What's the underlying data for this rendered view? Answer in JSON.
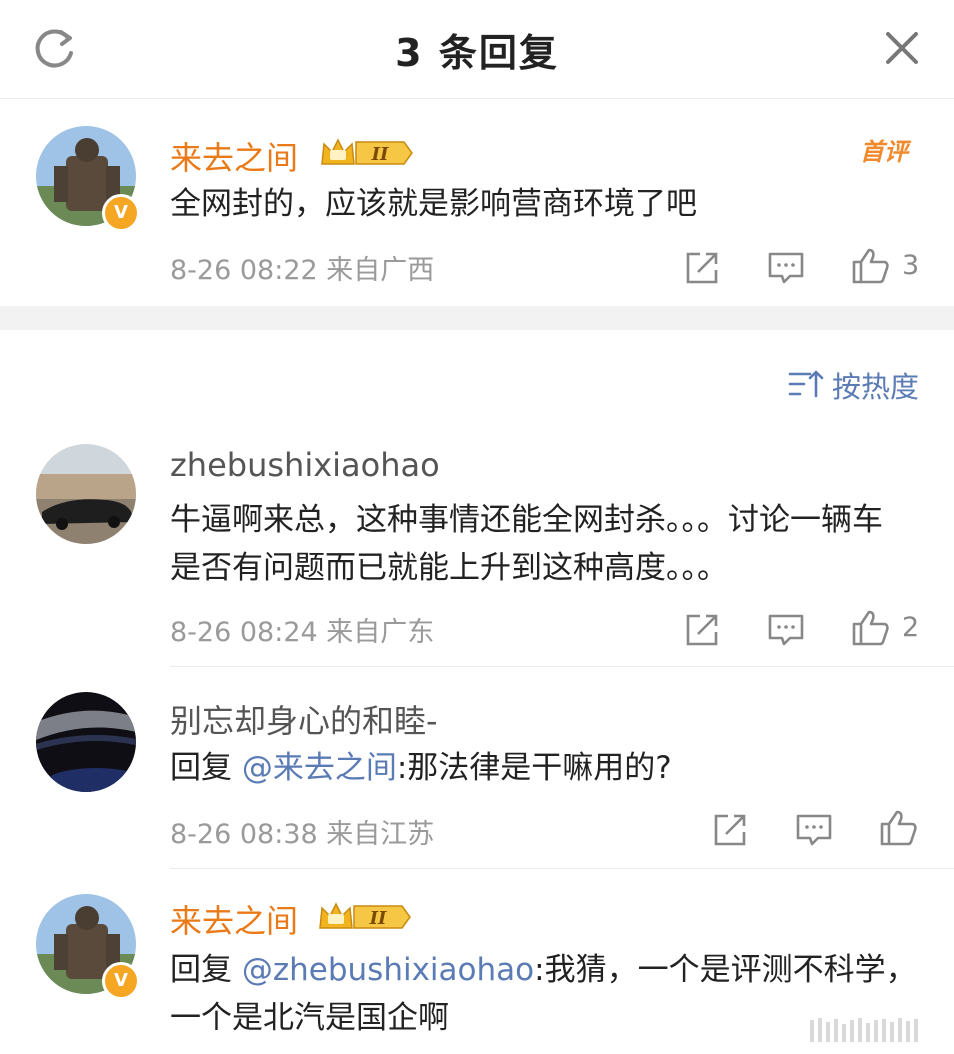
{
  "header": {
    "title": "3 条回复"
  },
  "main_comment": {
    "username": "来去之间",
    "badge_level": "II",
    "first_comment_label": "首评",
    "text": "全网封的，应该就是影响营商环境了吧",
    "time": "8-26 08:22",
    "location": "来自广西",
    "like_count": "3"
  },
  "sort": {
    "label": "按热度"
  },
  "replies": [
    {
      "username": "zhebushixiaohao",
      "line1": "牛逼啊来总，这种事情还能全网封杀。。。讨论一辆车",
      "line2": "是否有问题而已就能上升到这种高度。。。",
      "time": "8-26 08:24",
      "location": "来自广东",
      "like_count": "2"
    },
    {
      "username": "别忘却身心的和睦-",
      "reply_prefix": "回复",
      "mention": "@来去之间",
      "text": ":那法律是干嘛用的?",
      "time": "8-26 08:38",
      "location": "来自江苏"
    },
    {
      "username": "来去之间",
      "badge_level": "II",
      "reply_prefix": "回复",
      "mention": "@zhebushixiaohao",
      "text": ":我猜，一个是评测不科学，",
      "line2": "一个是北汽是国企啊"
    }
  ],
  "colors": {
    "orange_name": "#ea7a17",
    "link_blue": "#5b7bb5",
    "meta_gray": "#9a9a9a",
    "badge_gold": "#f5a623"
  },
  "icons": [
    "refresh-icon",
    "close-icon",
    "share-icon",
    "comment-icon",
    "like-icon",
    "sort-icon",
    "crown-badge-icon",
    "verified-badge-icon"
  ]
}
